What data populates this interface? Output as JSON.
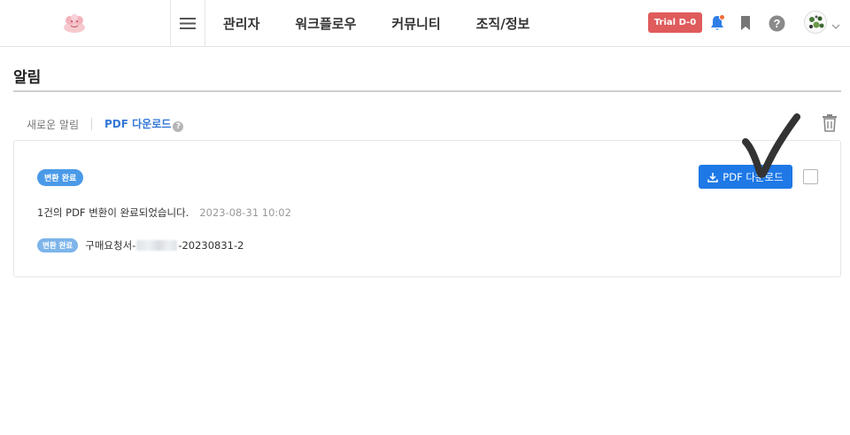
{
  "header": {
    "nav": [
      "관리자",
      "워크플로우",
      "커뮤니티",
      "조직/정보"
    ],
    "trial_badge": "Trial D-0",
    "icons": [
      "logo-icon",
      "hamburger-menu-icon",
      "bell-icon",
      "bookmark-icon",
      "help-circle-icon",
      "avatar",
      "chevron-down-icon"
    ],
    "notification_dot_color": "#f06a35"
  },
  "page": {
    "title": "알림"
  },
  "tabs": {
    "new_alerts": "새로운 알림",
    "pdf_download": "PDF 다운로드",
    "help_glyph": "?"
  },
  "notification": {
    "status": "변환 완료",
    "message": "1건의 PDF 변환이 완료되었습니다.",
    "timestamp": "2023-08-31 10:02",
    "file_status": "변환 완료",
    "file_name_prefix": "구매요청서-",
    "file_name_suffix": "-20230831-2",
    "download_button": "PDF 다운로드",
    "checked": false
  },
  "colors": {
    "accent": "#1e78e6",
    "badge": "#4a9ae8",
    "trial": "#e05b5b",
    "active_tab": "#3478d6"
  }
}
